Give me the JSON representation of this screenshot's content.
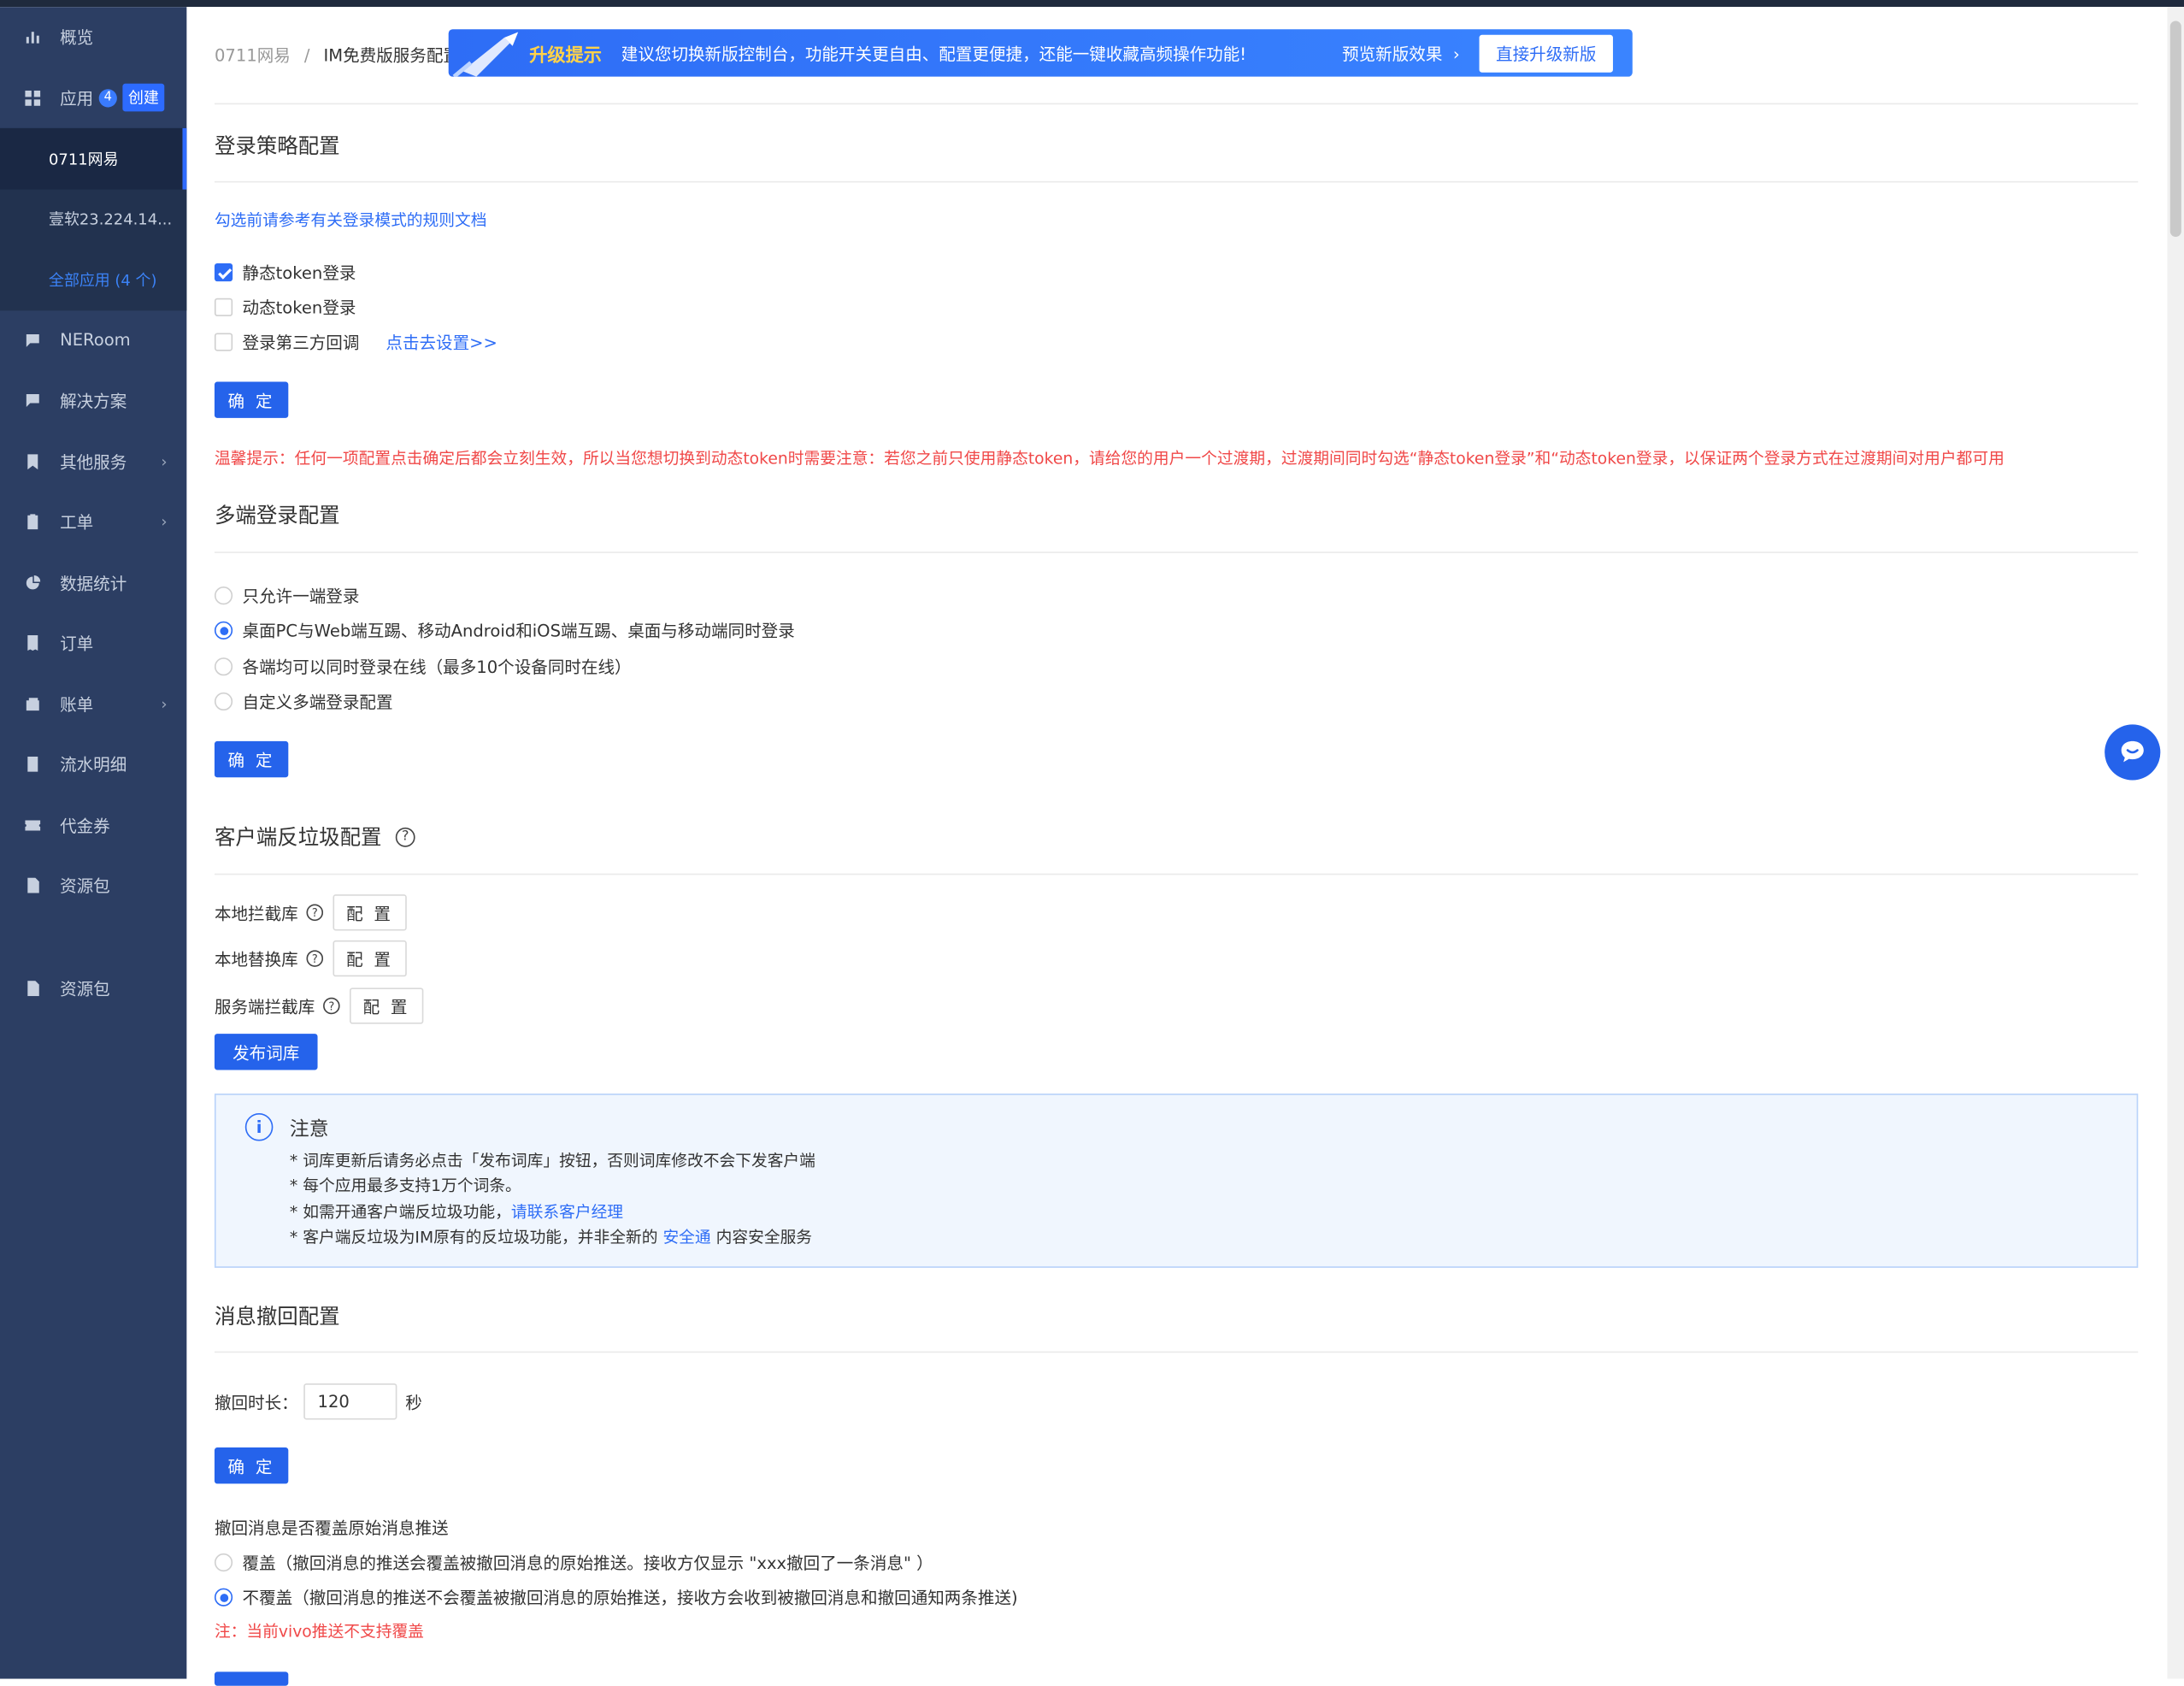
{
  "sidebar": {
    "overview": "概览",
    "apps": {
      "label": "应用",
      "count": "4",
      "create": "创建"
    },
    "sub_items": [
      {
        "label": "0711网易"
      },
      {
        "label": "壹软23.224.14..."
      },
      {
        "label": "全部应用 (4 个)"
      }
    ],
    "items": [
      {
        "label": "NERoom",
        "icon": "chat-icon"
      },
      {
        "label": "解决方案",
        "icon": "chat-icon"
      },
      {
        "label": "其他服务",
        "icon": "bookmark-icon"
      },
      {
        "label": "工单",
        "icon": "clipboard-icon"
      },
      {
        "label": "数据统计",
        "icon": "pie-chart-icon"
      },
      {
        "label": "订单",
        "icon": "receipt-icon"
      },
      {
        "label": "账单",
        "icon": "wallet-icon"
      },
      {
        "label": "流水明细",
        "icon": "document-icon"
      },
      {
        "label": "代金券",
        "icon": "ticket-icon"
      },
      {
        "label": "资源包",
        "icon": "file-icon"
      },
      {
        "label": "资源包",
        "icon": "file-icon"
      }
    ]
  },
  "breadcrumb": {
    "parent": "0711网易",
    "separator": "/",
    "current": "IM免费版服务配置"
  },
  "banner": {
    "title": "升级提示",
    "text": "建议您切换新版控制台，功能开关更自由、配置更便捷，还能一键收藏高频操作功能!",
    "preview": "预览新版效果",
    "upgrade": "直接升级新版"
  },
  "login_strategy": {
    "title": "登录策略配置",
    "doc_link": "勾选前请参考有关登录模式的规则文档",
    "options": [
      {
        "label": "静态token登录",
        "checked": true
      },
      {
        "label": "动态token登录",
        "checked": false
      },
      {
        "label": "登录第三方回调",
        "checked": false
      }
    ],
    "setting_link": "点击去设置>>",
    "confirm": "确 定",
    "warning": "温馨提示：任何一项配置点击确定后都会立刻生效，所以当您想切换到动态token时需要注意：若您之前只使用静态token，请给您的用户一个过渡期，过渡期间同时勾选“静态token登录”和“动态token登录，以保证两个登录方式在过渡期间对用户都可用"
  },
  "multi_login": {
    "title": "多端登录配置",
    "options": [
      {
        "label": "只允许一端登录",
        "selected": false
      },
      {
        "label": "桌面PC与Web端互踢、移动Android和iOS端互踢、桌面与移动端同时登录",
        "selected": true
      },
      {
        "label": "各端均可以同时登录在线（最多10个设备同时在线）",
        "selected": false
      },
      {
        "label": "自定义多端登录配置",
        "selected": false
      }
    ],
    "confirm": "确 定"
  },
  "anti_spam": {
    "title": "客户端反垃圾配置",
    "rows": [
      {
        "label": "本地拦截库",
        "button": "配 置"
      },
      {
        "label": "本地替换库",
        "button": "配 置"
      },
      {
        "label": "服务端拦截库",
        "button": "配 置"
      }
    ],
    "publish": "发布词库",
    "notice": {
      "title": "注意",
      "line1": "* 词库更新后请务必点击「发布词库」按钮，否则词库修改不会下发客户端",
      "line2": "* 每个应用最多支持1万个词条。",
      "line3_prefix": "* 如需开通客户端反垃圾功能，",
      "line3_link": "请联系客户经理",
      "line4_prefix": "* 客户端反垃圾为IM原有的反垃圾功能，并非全新的 ",
      "line4_link": "安全通",
      "line4_suffix": " 内容安全服务"
    }
  },
  "recall": {
    "title": "消息撤回配置",
    "duration_label": "撤回时长：",
    "duration_value": "120",
    "unit": "秒",
    "confirm": "确 定",
    "push_question": "撤回消息是否覆盖原始消息推送",
    "options": [
      {
        "label": "覆盖（撤回消息的推送会覆盖被撤回消息的原始推送。接收方仅显示 \"xxx撤回了一条消息\" ）",
        "selected": false
      },
      {
        "label": "不覆盖（撤回消息的推送不会覆盖被撤回消息的原始推送，接收方会收到被撤回消息和撤回通知两条推送)",
        "selected": true
      }
    ],
    "note": "注：当前vivo推送不支持覆盖"
  },
  "colors": {
    "primary": "#2563eb",
    "sidebar": "#2c3e63",
    "warning": "#f04848",
    "banner_title": "#ffd24a"
  }
}
